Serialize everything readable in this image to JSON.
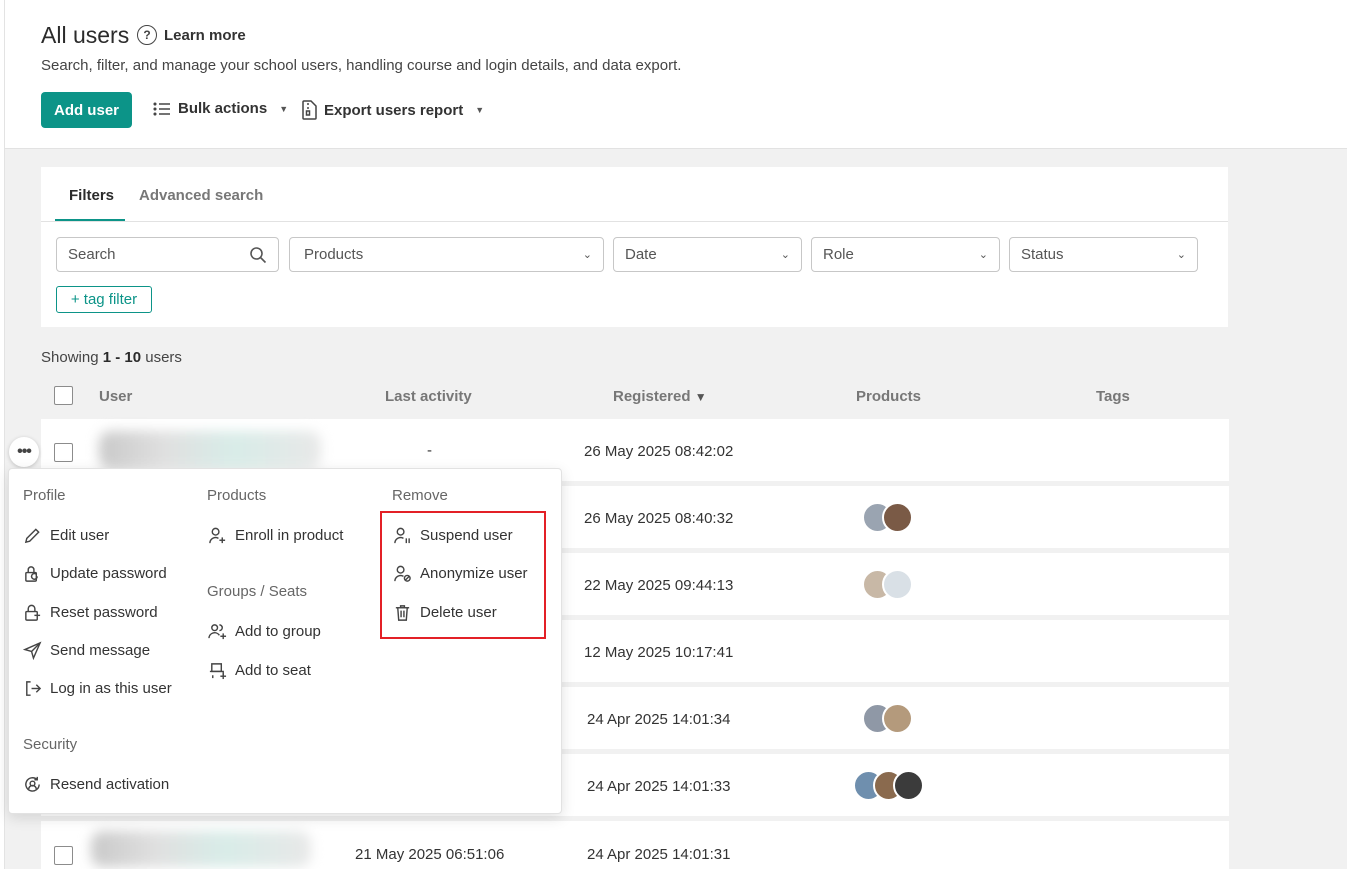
{
  "header": {
    "title": "All users",
    "learn_more": "Learn more",
    "subtitle": "Search, filter, and manage your school users, handling course and login details, and data export.",
    "add_user": "Add user",
    "bulk_actions": "Bulk actions",
    "export_report": "Export users report"
  },
  "filters": {
    "tab_filters": "Filters",
    "tab_advanced": "Advanced search",
    "search_placeholder": "Search",
    "products": "Products",
    "date": "Date",
    "role": "Role",
    "status": "Status",
    "tag_filter": "+ tag filter"
  },
  "showing": {
    "prefix": "Showing ",
    "range": "1 - 10",
    "suffix": " users"
  },
  "table": {
    "headers": {
      "user": "User",
      "last_activity": "Last activity",
      "registered": "Registered",
      "sort_icon": "▼",
      "products": "Products",
      "tags": "Tags"
    },
    "rows": [
      {
        "last_activity": "-",
        "registered": "26 May 2025 08:42:02"
      },
      {
        "last_activity": "",
        "registered": "26 May 2025 08:40:32"
      },
      {
        "last_activity": "",
        "registered": "22 May 2025 09:44:13"
      },
      {
        "last_activity": "",
        "registered": "12 May 2025 10:17:41"
      },
      {
        "last_activity": "",
        "registered": "24 Apr 2025 14:01:34"
      },
      {
        "last_activity": "",
        "registered": "24 Apr 2025 14:01:33"
      },
      {
        "last_activity": "21 May 2025 06:51:06",
        "registered": "24 Apr 2025 14:01:31"
      }
    ]
  },
  "menu": {
    "profile": {
      "heading": "Profile",
      "items": [
        "Edit user",
        "Update password",
        "Reset password",
        "Send message",
        "Log in as this user"
      ]
    },
    "security": {
      "heading": "Security",
      "items": [
        "Resend activation"
      ]
    },
    "products": {
      "heading": "Products",
      "items": [
        "Enroll in product"
      ]
    },
    "groups": {
      "heading": "Groups / Seats",
      "items": [
        "Add to group",
        "Add to seat"
      ]
    },
    "remove": {
      "heading": "Remove",
      "items": [
        "Suspend user",
        "Anonymize user",
        "Delete user"
      ]
    }
  },
  "colors": {
    "accent": "#0c9488",
    "highlight": "#e32026"
  }
}
